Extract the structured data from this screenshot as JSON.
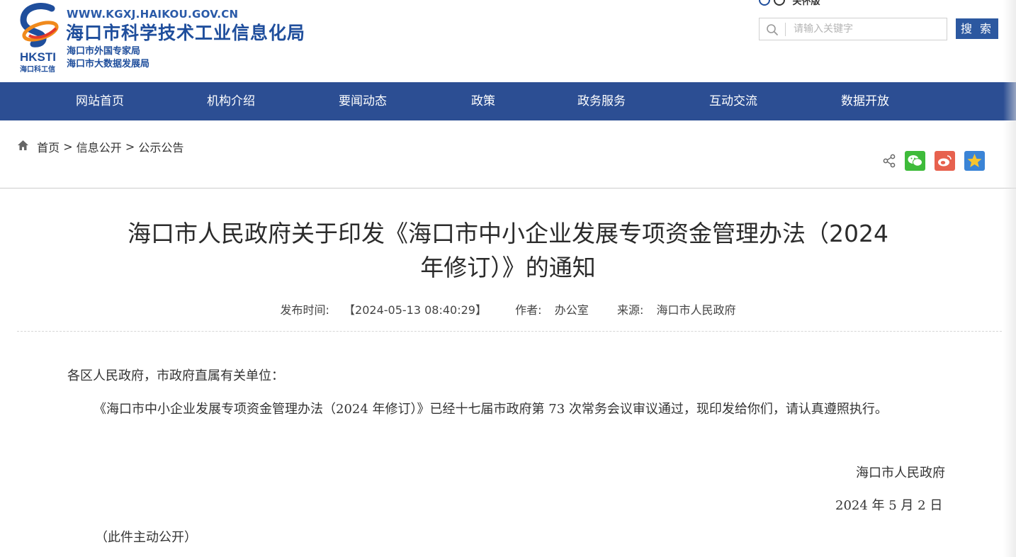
{
  "header": {
    "url": "WWW.KGXJ.HAIKOU.GOV.CN",
    "site_name": "海口市科学技术工业信息化局",
    "subtitle_1": "海口市外国专家局",
    "subtitle_2": "海口市大数据发展局",
    "logo_text": "HKSTI",
    "logo_caption": "海口科工信",
    "care_mode_label": "关怀版",
    "search": {
      "placeholder": "请输入关键字",
      "button_label": "搜 索"
    }
  },
  "nav": {
    "items": [
      {
        "label": "网站首页"
      },
      {
        "label": "机构介绍"
      },
      {
        "label": "要闻动态"
      },
      {
        "label": "政策"
      },
      {
        "label": "政务服务"
      },
      {
        "label": "互动交流"
      },
      {
        "label": "数据开放"
      }
    ]
  },
  "breadcrumb": {
    "home": "首页",
    "separator": ">",
    "level2": "信息公开",
    "level3": "公示公告"
  },
  "share": {
    "icons": [
      "share-icon",
      "wechat-icon",
      "weibo-icon",
      "qzone-icon"
    ],
    "colors": {
      "wechat": "#3ebb3a",
      "weibo": "#e7614e",
      "qzone": "#3b84d6"
    }
  },
  "article": {
    "title_line1": "海口市人民政府关于印发《海口市中小企业发展专项资金管理办法（2024",
    "title_line2": "年修订）》的通知",
    "publish_label": "发布时间:",
    "publish_time": "【2024-05-13 08:40:29】",
    "author_label": "作者:",
    "author": "办公室",
    "source_label": "来源:",
    "source": "海口市人民政府",
    "salutation": "各区人民政府，市政府直属有关单位：",
    "paragraph": "《海口市中小企业发展专项资金管理办法（2024 年修订）》已经十七届市政府第 73 次常务会议审议通过，现印发给你们，请认真遵照执行。",
    "signature": "海口市人民政府",
    "date": "2024 年 5 月 2 日",
    "disclosure": "（此件主动公开）"
  },
  "colors": {
    "nav_bg": "#2c4e93",
    "brand_blue": "#1f4e9c",
    "search_button": "#2c58a0"
  }
}
